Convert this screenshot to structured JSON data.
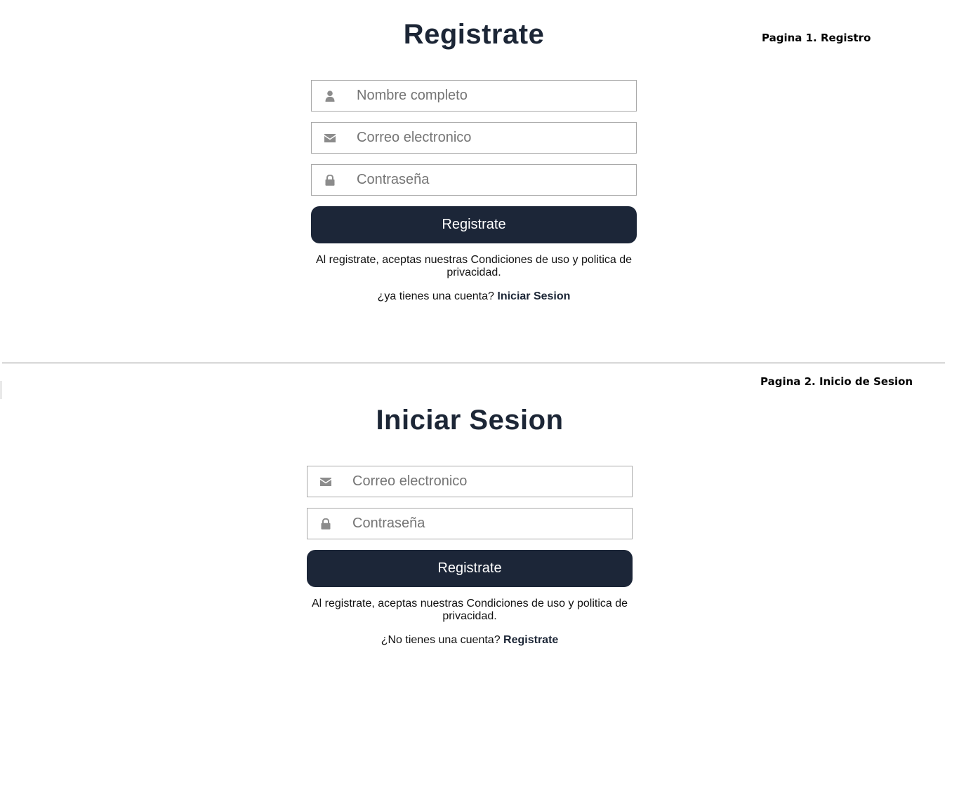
{
  "colors": {
    "primary": "#1c2638",
    "title": "#1c2636",
    "icon": "#8c8c8c",
    "border": "#a9a9a9",
    "divider": "#8a8a8a"
  },
  "register_page": {
    "page_label": "Pagina 1. Registro",
    "title": "Registrate",
    "fields": {
      "name": {
        "icon": "user-icon",
        "placeholder": "Nombre completo",
        "value": ""
      },
      "email": {
        "icon": "envelope-icon",
        "placeholder": "Correo electronico",
        "value": ""
      },
      "password": {
        "icon": "lock-icon",
        "placeholder": "Contraseña",
        "value": ""
      }
    },
    "submit_label": "Registrate",
    "terms": "Al registrate, aceptas nuestras Condiciones de uso y politica de privacidad.",
    "switch_text": "¿ya tienes una cuenta?",
    "switch_link": "Iniciar Sesion"
  },
  "login_page": {
    "page_label": "Pagina 2. Inicio de Sesion",
    "title": "Iniciar Sesion",
    "fields": {
      "email": {
        "icon": "envelope-icon",
        "placeholder": "Correo electronico",
        "value": ""
      },
      "password": {
        "icon": "lock-icon",
        "placeholder": "Contraseña",
        "value": ""
      }
    },
    "submit_label": "Registrate",
    "terms": "Al registrate, aceptas nuestras Condiciones de uso y politica de privacidad.",
    "switch_text": "¿No tienes una cuenta?",
    "switch_link": "Registrate"
  }
}
